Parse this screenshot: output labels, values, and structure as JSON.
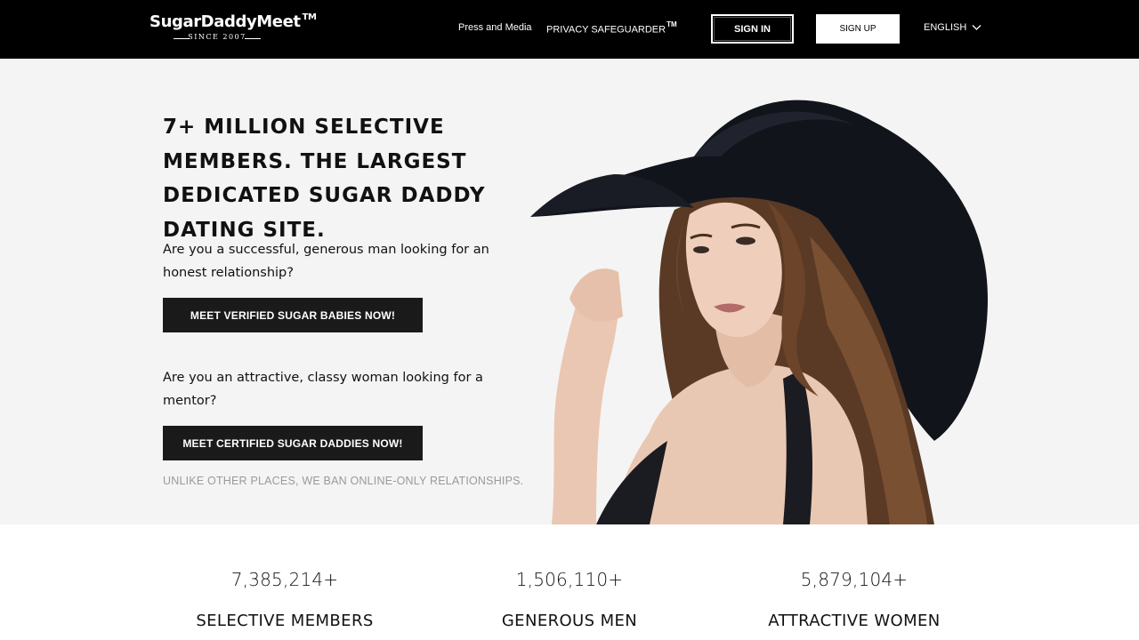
{
  "header": {
    "logo_text": "SugarDaddyMeet",
    "logo_tm": "TM",
    "logo_tagline": "SINCE 2007",
    "nav": {
      "press": "Press and Media",
      "privacy": "PRIVACY SAFEGUARDER",
      "privacy_tm": "TM"
    },
    "sign_in": "SIGN IN",
    "sign_up": "SIGN UP",
    "language": "ENGLISH",
    "language_icon": "chevron-down-icon"
  },
  "hero": {
    "headline": "7+ MILLION SELECTIVE MEMBERS. THE LARGEST DEDICATED SUGAR DADDY DATING SITE.",
    "question_men": "Are you a successful, generous man looking for an honest relationship?",
    "cta_men": "MEET VERIFIED SUGAR BABIES NOW!",
    "question_women": "Are you an attractive, classy woman looking for a mentor?",
    "cta_women": "MEET CERTIFIED SUGAR DADDIES NOW!",
    "note": "UNLIKE OTHER PLACES, WE BAN ONLINE-ONLY RELATIONSHIPS."
  },
  "stats": [
    {
      "value": "7,385,214+",
      "label": "SELECTIVE MEMBERS"
    },
    {
      "value": "1,506,110+",
      "label": "GENEROUS MEN"
    },
    {
      "value": "5,879,104+",
      "label": "ATTRACTIVE WOMEN"
    }
  ],
  "colors": {
    "header_bg": "#000000",
    "hero_bg": "#f4f4f4",
    "cta_bg": "#1a1a1a",
    "note_text": "#9a9a9a"
  }
}
